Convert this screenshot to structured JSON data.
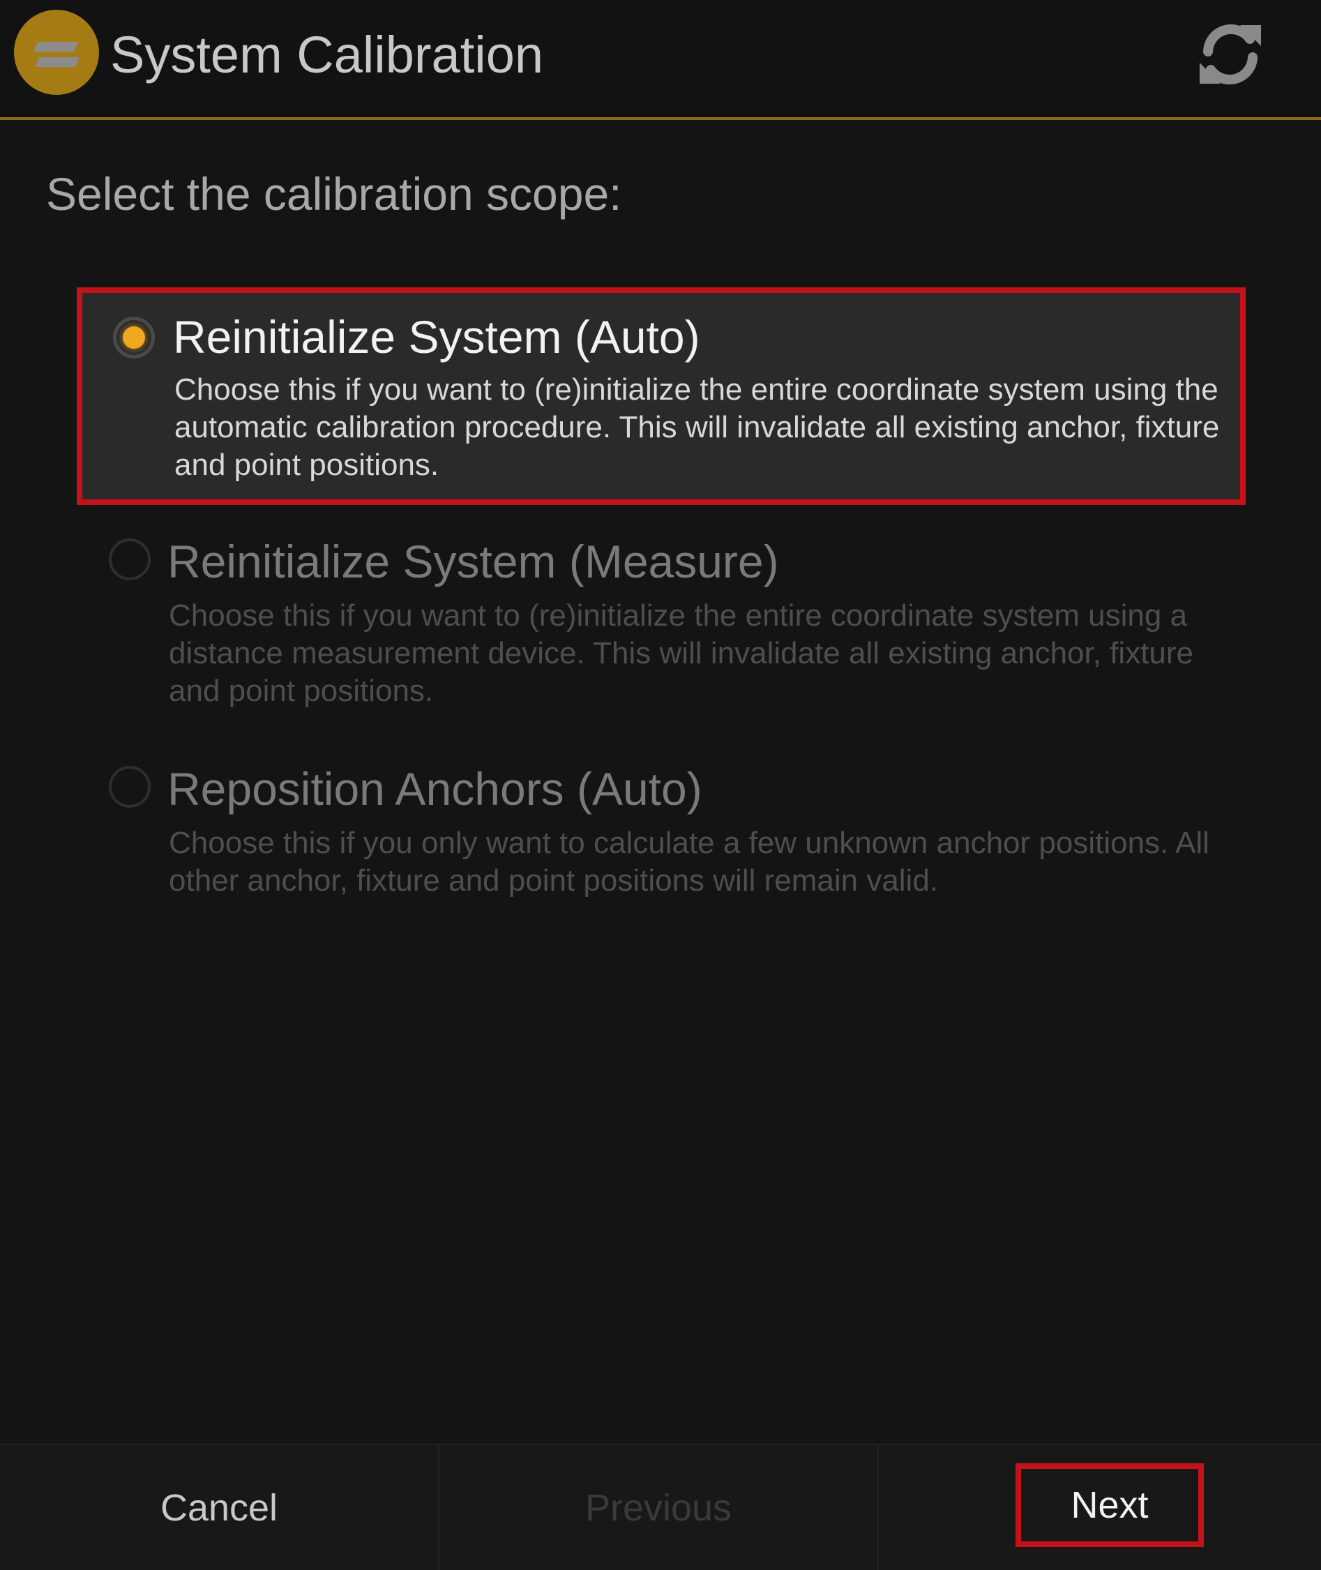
{
  "header": {
    "title": "System Calibration",
    "logo_icon": "app-logo-icon",
    "refresh_icon": "refresh-icon"
  },
  "prompt": "Select the calibration scope:",
  "options": [
    {
      "title": "Reinitialize System (Auto)",
      "description": "Choose this if you want to (re)initialize the entire coordinate system using the automatic calibration procedure. This will invalidate all existing anchor, fixture and point positions.",
      "selected": true
    },
    {
      "title": "Reinitialize System (Measure)",
      "description": "Choose this if you want to (re)initialize the entire coordinate system using a distance measurement device. This will invalidate all existing anchor, fixture and point positions.",
      "selected": false
    },
    {
      "title": "Reposition Anchors (Auto)",
      "description": "Choose this if you only want to calculate a few unknown anchor positions. All other anchor, fixture and point positions will remain valid.",
      "selected": false
    }
  ],
  "footer": {
    "cancel_label": "Cancel",
    "previous_label": "Previous",
    "next_label": "Next"
  },
  "colors": {
    "accent": "#f0a81c",
    "logo": "#a57c14",
    "highlight_border": "#c4121a",
    "background": "#141414"
  }
}
